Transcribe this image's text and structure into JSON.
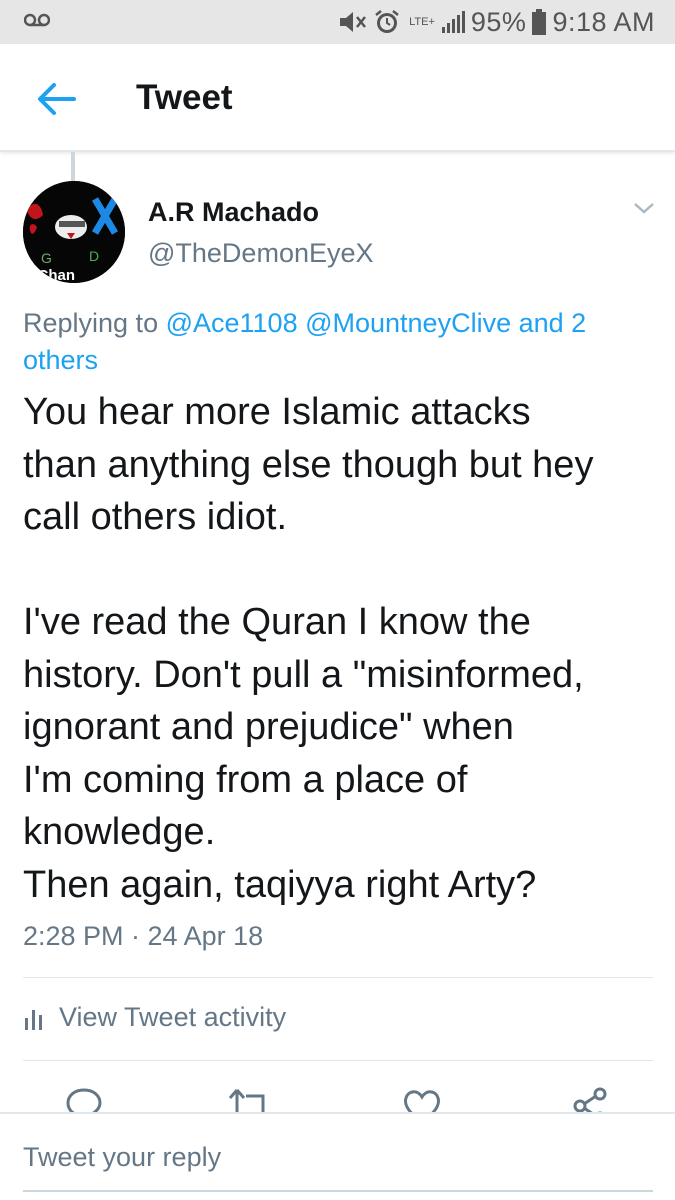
{
  "status_bar": {
    "battery": "95%",
    "time": "9:18 AM",
    "network": "LTE+",
    "icons": [
      "voicemail-icon",
      "mute-icon",
      "alarm-icon",
      "signal-icon",
      "battery-icon"
    ]
  },
  "header": {
    "title": "Tweet",
    "back_icon": "back-arrow-icon"
  },
  "tweet": {
    "author_name": "A.R Machado",
    "author_handle": "@TheDemonEyeX",
    "avatar_text": "e Chan",
    "avatar_letters": [
      "G",
      "D"
    ],
    "replying_prefix": "Replying to ",
    "replying_mentions": "@Ace1108 @MountneyClive and 2 others",
    "text_lines": [
      "You hear more Islamic attacks",
      "than anything else though but hey",
      "call others idiot.",
      "",
      "I've read the Quran I know the",
      "history. Don't pull a \"misinformed,",
      "ignorant and prejudice\" when",
      "I'm coming from a place of",
      "knowledge.",
      "Then again, taqiyya right Arty?"
    ],
    "timestamp": "2:28 PM · 24 Apr 18"
  },
  "activity": {
    "label": "View Tweet activity"
  },
  "actions": [
    "reply-icon",
    "retweet-icon",
    "like-icon",
    "share-icon"
  ],
  "reply_bar": {
    "placeholder": "Tweet your reply"
  },
  "colors": {
    "accent": "#1da1f2",
    "secondary_text": "#657786",
    "primary_text": "#14171a",
    "status_bar_bg": "#e6e6e6"
  }
}
